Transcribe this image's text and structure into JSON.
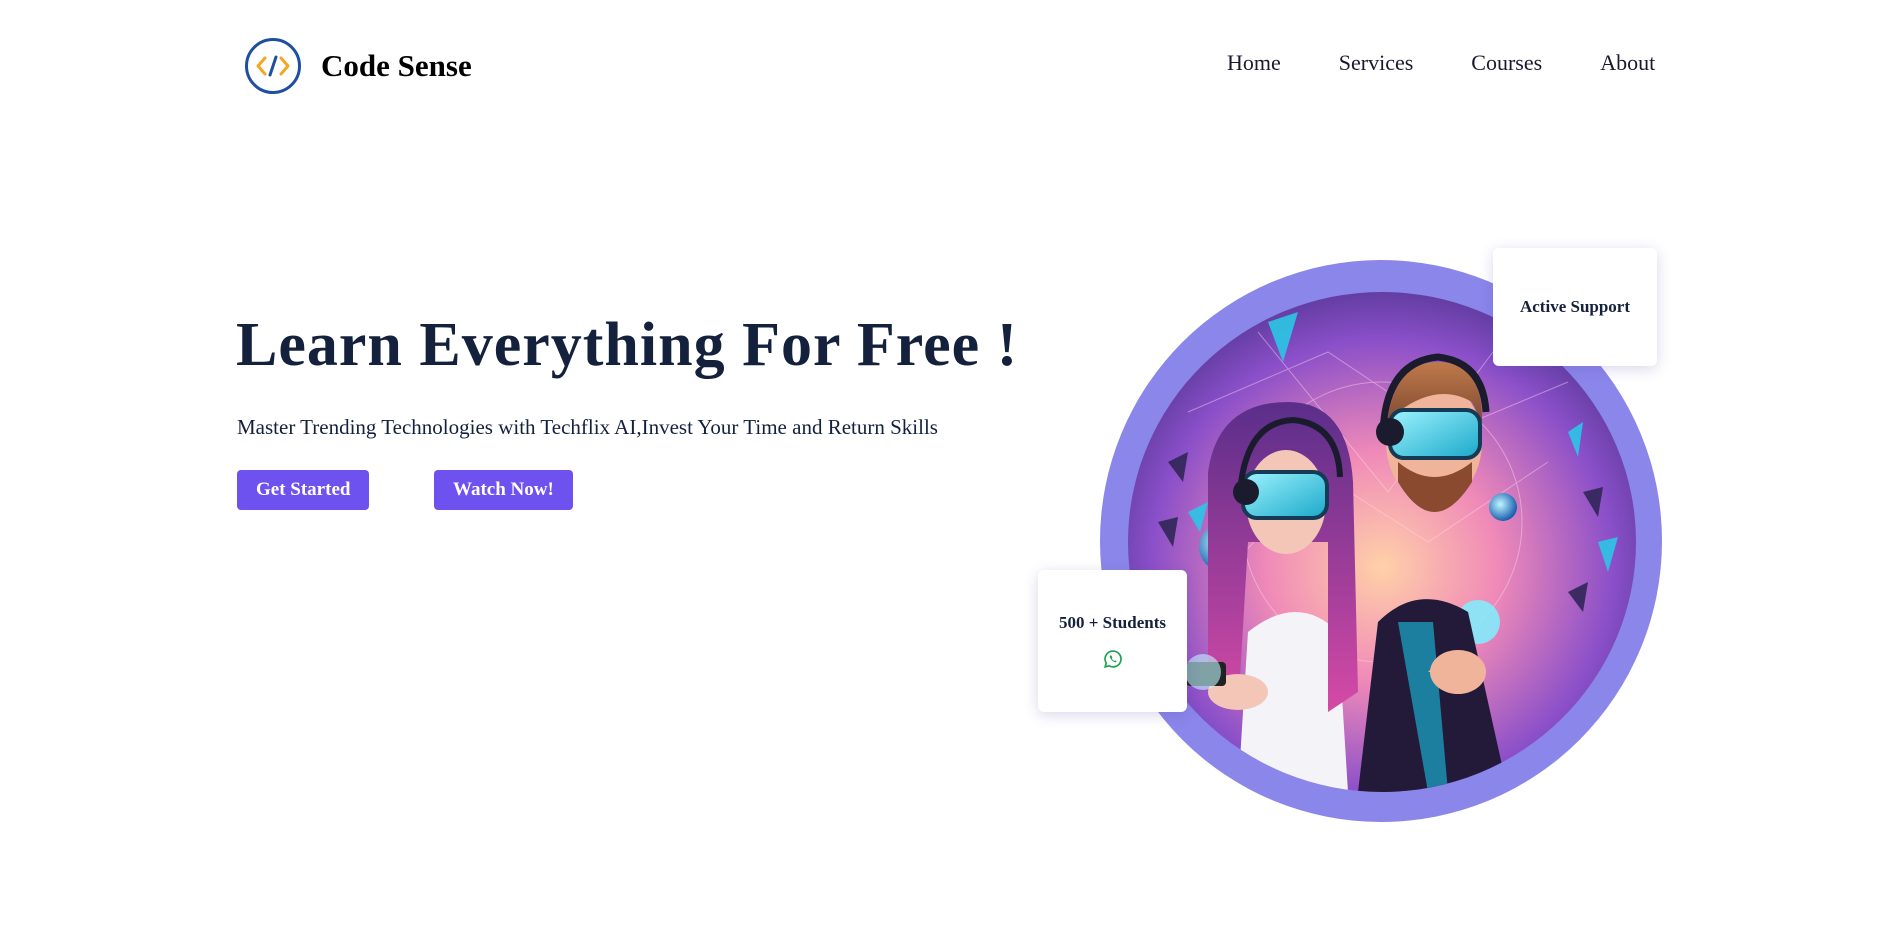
{
  "nav": {
    "brand": "Code Sense",
    "logo_icon": "code-brackets-icon",
    "items": [
      {
        "label": "Home"
      },
      {
        "label": "Services"
      },
      {
        "label": "Courses"
      },
      {
        "label": "About"
      }
    ]
  },
  "hero": {
    "title": "Learn Everything For Free !",
    "subtitle": "Master Trending Technologies with Techflix AI,Invest Your Time and Return Skills",
    "primary_button": "Get Started",
    "secondary_button": "Watch Now!"
  },
  "cards": {
    "support": "Active Support",
    "students": "500 + Students",
    "students_icon": "whatsapp-icon"
  },
  "colors": {
    "accent": "#6d52f0",
    "ring": "#8b86ea",
    "heading": "#14213d",
    "logo_blue": "#1f4fa0",
    "logo_orange": "#f5a623",
    "whatsapp": "#1aa34a"
  }
}
